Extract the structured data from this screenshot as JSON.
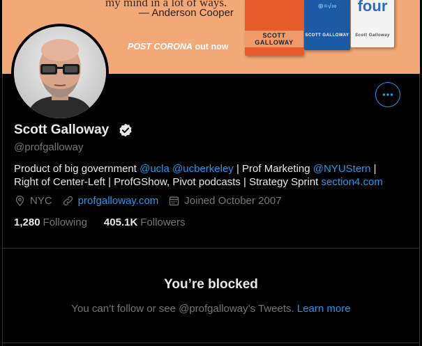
{
  "banner": {
    "quote_line1": "my mind in a lot of ways.",
    "quote_line2": "— Anderson Cooper",
    "tagline_prefix": "POST CORONA",
    "tagline_suffix": " out now",
    "book1_author": "SCOTT GALLOWAY",
    "book2_top": "⊕=√∞",
    "book2_author": "SCOTT GALLOWAY",
    "book3_title": "four",
    "book3_author": "Scott Galloway"
  },
  "profile": {
    "name": "Scott Galloway",
    "handle": "@profgalloway",
    "bio": {
      "p1": "Product of big government ",
      "m1": "@ucla",
      "p2": " ",
      "m2": "@ucberkeley",
      "p3": " | Prof Marketing ",
      "m3": "@NYUStern",
      "p4": " |",
      "p5": "Right of Center-Left | ProfGShow, Pivot podcasts | Strategy Sprint ",
      "m4": "section4.com"
    },
    "location": "NYC",
    "website": "profgalloway.com",
    "joined": "Joined October 2007",
    "following_count": "1,280",
    "following_label": "Following",
    "followers_count": "405.1K",
    "followers_label": "Followers"
  },
  "blocked": {
    "title": "You’re blocked",
    "text": "You can’t follow or see @profgalloway’s Tweets. ",
    "learn_more": "Learn more"
  },
  "colors": {
    "accent": "#1d9bf0",
    "banner": "#f3a977"
  }
}
